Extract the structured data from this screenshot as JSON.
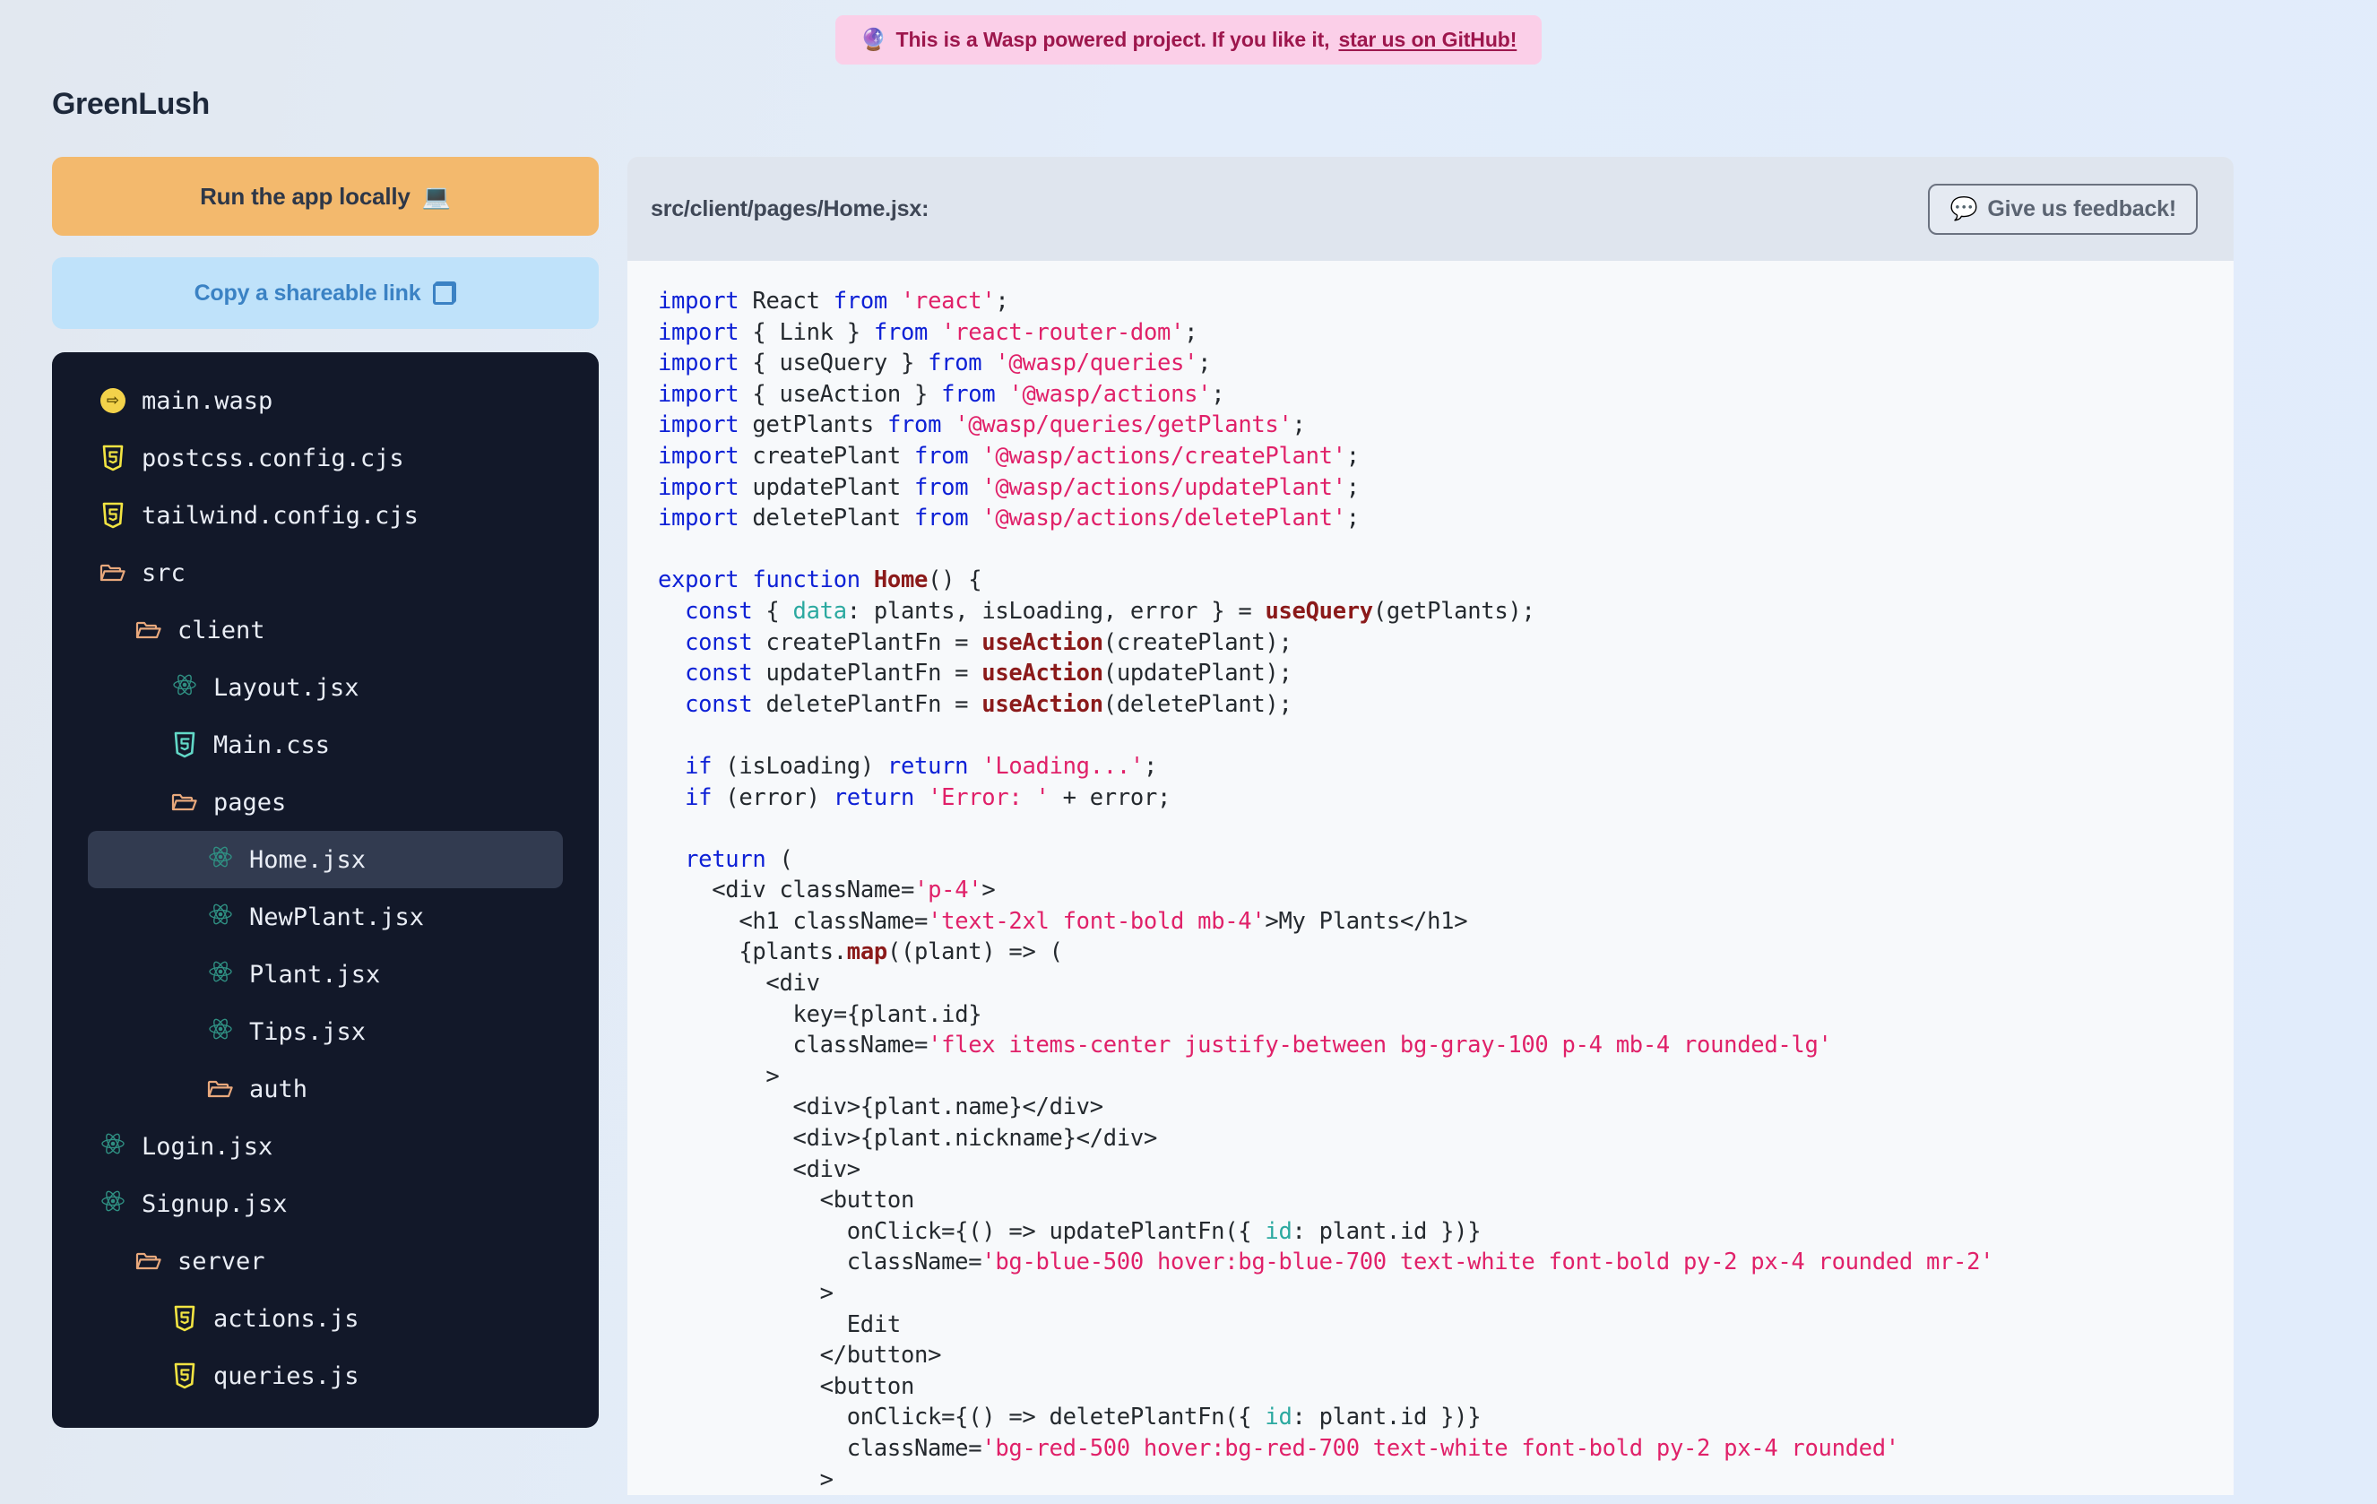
{
  "banner": {
    "emoji": "🔮",
    "text": "This is a Wasp powered project. If you like it,",
    "link_text": "star us on GitHub!"
  },
  "app_title": "GreenLush",
  "sidebar": {
    "run_button": {
      "label": "Run the app locally",
      "emoji": "💻"
    },
    "share_button": {
      "label": "Copy a shareable link",
      "icon": "copy-icon"
    },
    "tree": [
      {
        "name": "main.wasp",
        "icon": "wasp-icon",
        "depth": 0,
        "selected": false
      },
      {
        "name": "postcss.config.cjs",
        "icon": "js-file-icon",
        "depth": 0,
        "selected": false
      },
      {
        "name": "tailwind.config.cjs",
        "icon": "js-file-icon",
        "depth": 0,
        "selected": false
      },
      {
        "name": "src",
        "icon": "folder-icon",
        "depth": 0,
        "selected": false
      },
      {
        "name": "client",
        "icon": "folder-icon",
        "depth": 1,
        "selected": false
      },
      {
        "name": "Layout.jsx",
        "icon": "react-icon",
        "depth": 2,
        "selected": false
      },
      {
        "name": "Main.css",
        "icon": "css-file-icon",
        "depth": 2,
        "selected": false
      },
      {
        "name": "pages",
        "icon": "folder-icon",
        "depth": 2,
        "selected": false
      },
      {
        "name": "Home.jsx",
        "icon": "react-icon",
        "depth": 3,
        "selected": true
      },
      {
        "name": "NewPlant.jsx",
        "icon": "react-icon",
        "depth": 3,
        "selected": false
      },
      {
        "name": "Plant.jsx",
        "icon": "react-icon",
        "depth": 3,
        "selected": false
      },
      {
        "name": "Tips.jsx",
        "icon": "react-icon",
        "depth": 3,
        "selected": false
      },
      {
        "name": "auth",
        "icon": "folder-icon",
        "depth": 3,
        "selected": false
      },
      {
        "name": "Login.jsx",
        "icon": "react-icon",
        "depth": 4,
        "selected": false
      },
      {
        "name": "Signup.jsx",
        "icon": "react-icon",
        "depth": 4,
        "selected": false
      },
      {
        "name": "server",
        "icon": "folder-icon",
        "depth": 1,
        "selected": false
      },
      {
        "name": "actions.js",
        "icon": "js-file-icon",
        "depth": 2,
        "selected": false
      },
      {
        "name": "queries.js",
        "icon": "js-file-icon",
        "depth": 2,
        "selected": false
      }
    ]
  },
  "editor": {
    "path": "src/client/pages/Home.jsx:",
    "feedback_button": {
      "label": "Give us feedback!",
      "emoji": "💬"
    },
    "language": "jsx",
    "code": "import React from 'react';\nimport { Link } from 'react-router-dom';\nimport { useQuery } from '@wasp/queries';\nimport { useAction } from '@wasp/actions';\nimport getPlants from '@wasp/queries/getPlants';\nimport createPlant from '@wasp/actions/createPlant';\nimport updatePlant from '@wasp/actions/updatePlant';\nimport deletePlant from '@wasp/actions/deletePlant';\n\nexport function Home() {\n  const { data: plants, isLoading, error } = useQuery(getPlants);\n  const createPlantFn = useAction(createPlant);\n  const updatePlantFn = useAction(updatePlant);\n  const deletePlantFn = useAction(deletePlant);\n\n  if (isLoading) return 'Loading...';\n  if (error) return 'Error: ' + error;\n\n  return (\n    <div className='p-4'>\n      <h1 className='text-2xl font-bold mb-4'>My Plants</h1>\n      {plants.map((plant) => (\n        <div\n          key={plant.id}\n          className='flex items-center justify-between bg-gray-100 p-4 mb-4 rounded-lg'\n        >\n          <div>{plant.name}</div>\n          <div>{plant.nickname}</div>\n          <div>\n            <button\n              onClick={() => updatePlantFn({ id: plant.id })}\n              className='bg-blue-500 hover:bg-blue-700 text-white font-bold py-2 px-4 rounded mr-2'\n            >\n              Edit\n            </button>\n            <button\n              onClick={() => deletePlantFn({ id: plant.id })}\n              className='bg-red-500 hover:bg-red-700 text-white font-bold py-2 px-4 rounded'\n            >"
  },
  "colors": {
    "accent_orange": "#f3b96d",
    "accent_blue": "#bfe2fa",
    "banner_bg": "#fbcfe8",
    "banner_fg": "#9d174d",
    "tree_bg": "#121829",
    "tree_selected": "#323b50",
    "editor_header_bg": "#dfe5ee",
    "code_bg": "#f7f9fb",
    "syntax_keyword": "#0e21d6",
    "syntax_string": "#e02169",
    "syntax_function": "#8b1a1a",
    "syntax_property": "#2ba9a0"
  }
}
